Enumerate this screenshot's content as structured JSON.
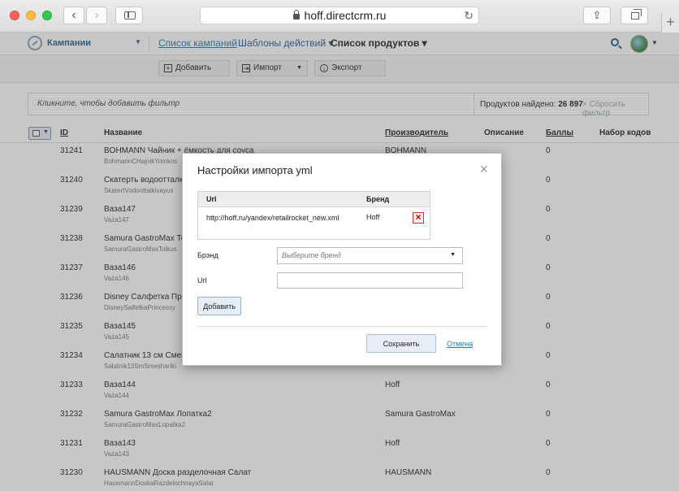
{
  "browser": {
    "url": "hoff.directcrm.ru"
  },
  "app": {
    "title": "Кампании",
    "nav": [
      "Список кампаний",
      "Шаблоны действий ▾",
      "Список продуктов ▾"
    ]
  },
  "toolbar": {
    "add": "Добавить",
    "import": "Импорт",
    "export": "Экспорт"
  },
  "filter": {
    "placeholder": "Кликните, чтобы добавить фильтр",
    "found_label": "Продуктов найдено:",
    "found_count": "26 897",
    "reset": "× Сбросить фильтр"
  },
  "table": {
    "headers": {
      "id": "ID",
      "name": "Название",
      "manufacturer": "Производитель",
      "description": "Описание",
      "points": "Баллы",
      "codes": "Набор кодов"
    },
    "rows": [
      {
        "id": "31241",
        "name": "BOHMANN Чайник + ёмкость для соуса",
        "code": "BohmannCHajnikYomkos",
        "mfr": "BOHMANN",
        "pts": "0"
      },
      {
        "id": "31240",
        "name": "Скатерть водоотталкив",
        "code": "SkatertVodoottalkivayus",
        "mfr": "",
        "pts": "0"
      },
      {
        "id": "31239",
        "name": "Ваза147",
        "code": "Vaza147",
        "mfr": "",
        "pts": "0"
      },
      {
        "id": "31238",
        "name": "Samura GastroMax Тол",
        "code": "SamuraGastroMaxTolkus",
        "mfr": "",
        "pts": "0"
      },
      {
        "id": "31237",
        "name": "Ваза146",
        "code": "Vaza146",
        "mfr": "",
        "pts": "0"
      },
      {
        "id": "31236",
        "name": "Disney Салфетка Прин",
        "code": "DisneySalfetkaPrincessy",
        "mfr": "",
        "pts": "0"
      },
      {
        "id": "31235",
        "name": "Ваза145",
        "code": "Vaza145",
        "mfr": "",
        "pts": "0"
      },
      {
        "id": "31234",
        "name": "Салатник 13 см Смеш",
        "code": "Salatnik13SmSmeshariki",
        "mfr": "",
        "pts": "0"
      },
      {
        "id": "31233",
        "name": "Ваза144",
        "code": "Vaza144",
        "mfr": "Hoff",
        "pts": "0"
      },
      {
        "id": "31232",
        "name": "Samura GastroMax Лопатка2",
        "code": "SamuraGastroMaxLopatka2",
        "mfr": "Samura GastroMax",
        "pts": "0"
      },
      {
        "id": "31231",
        "name": "Ваза143",
        "code": "Vaza143",
        "mfr": "Hoff",
        "pts": "0"
      },
      {
        "id": "31230",
        "name": "HAUSMANN Доска разделочная Салат",
        "code": "HausmannDoskaRazdelochnayaSalat",
        "mfr": "HAUSMANN",
        "pts": "0"
      }
    ]
  },
  "modal": {
    "title": "Настройки импорта yml",
    "table_headers": {
      "url": "Url",
      "brand": "Бренд"
    },
    "entry": {
      "url": "http://hoff.ru/yandex/retailrocket_new.xml",
      "brand": "Hoff"
    },
    "brand_label": "Брэнд",
    "brand_placeholder": "Выберите бренд",
    "url_label": "Url",
    "url_value": "",
    "add_button": "Добавить",
    "save_button": "Сохранить",
    "cancel_link": "Отмена"
  },
  "colors": {
    "link": "#2a7ab0",
    "brand_title": "#2a5d8c",
    "overlay": "rgba(80,80,80,0.32)"
  },
  "icons": [
    "search-icon",
    "lock-icon",
    "reload-icon",
    "close-icon",
    "delete-icon",
    "avatar"
  ]
}
